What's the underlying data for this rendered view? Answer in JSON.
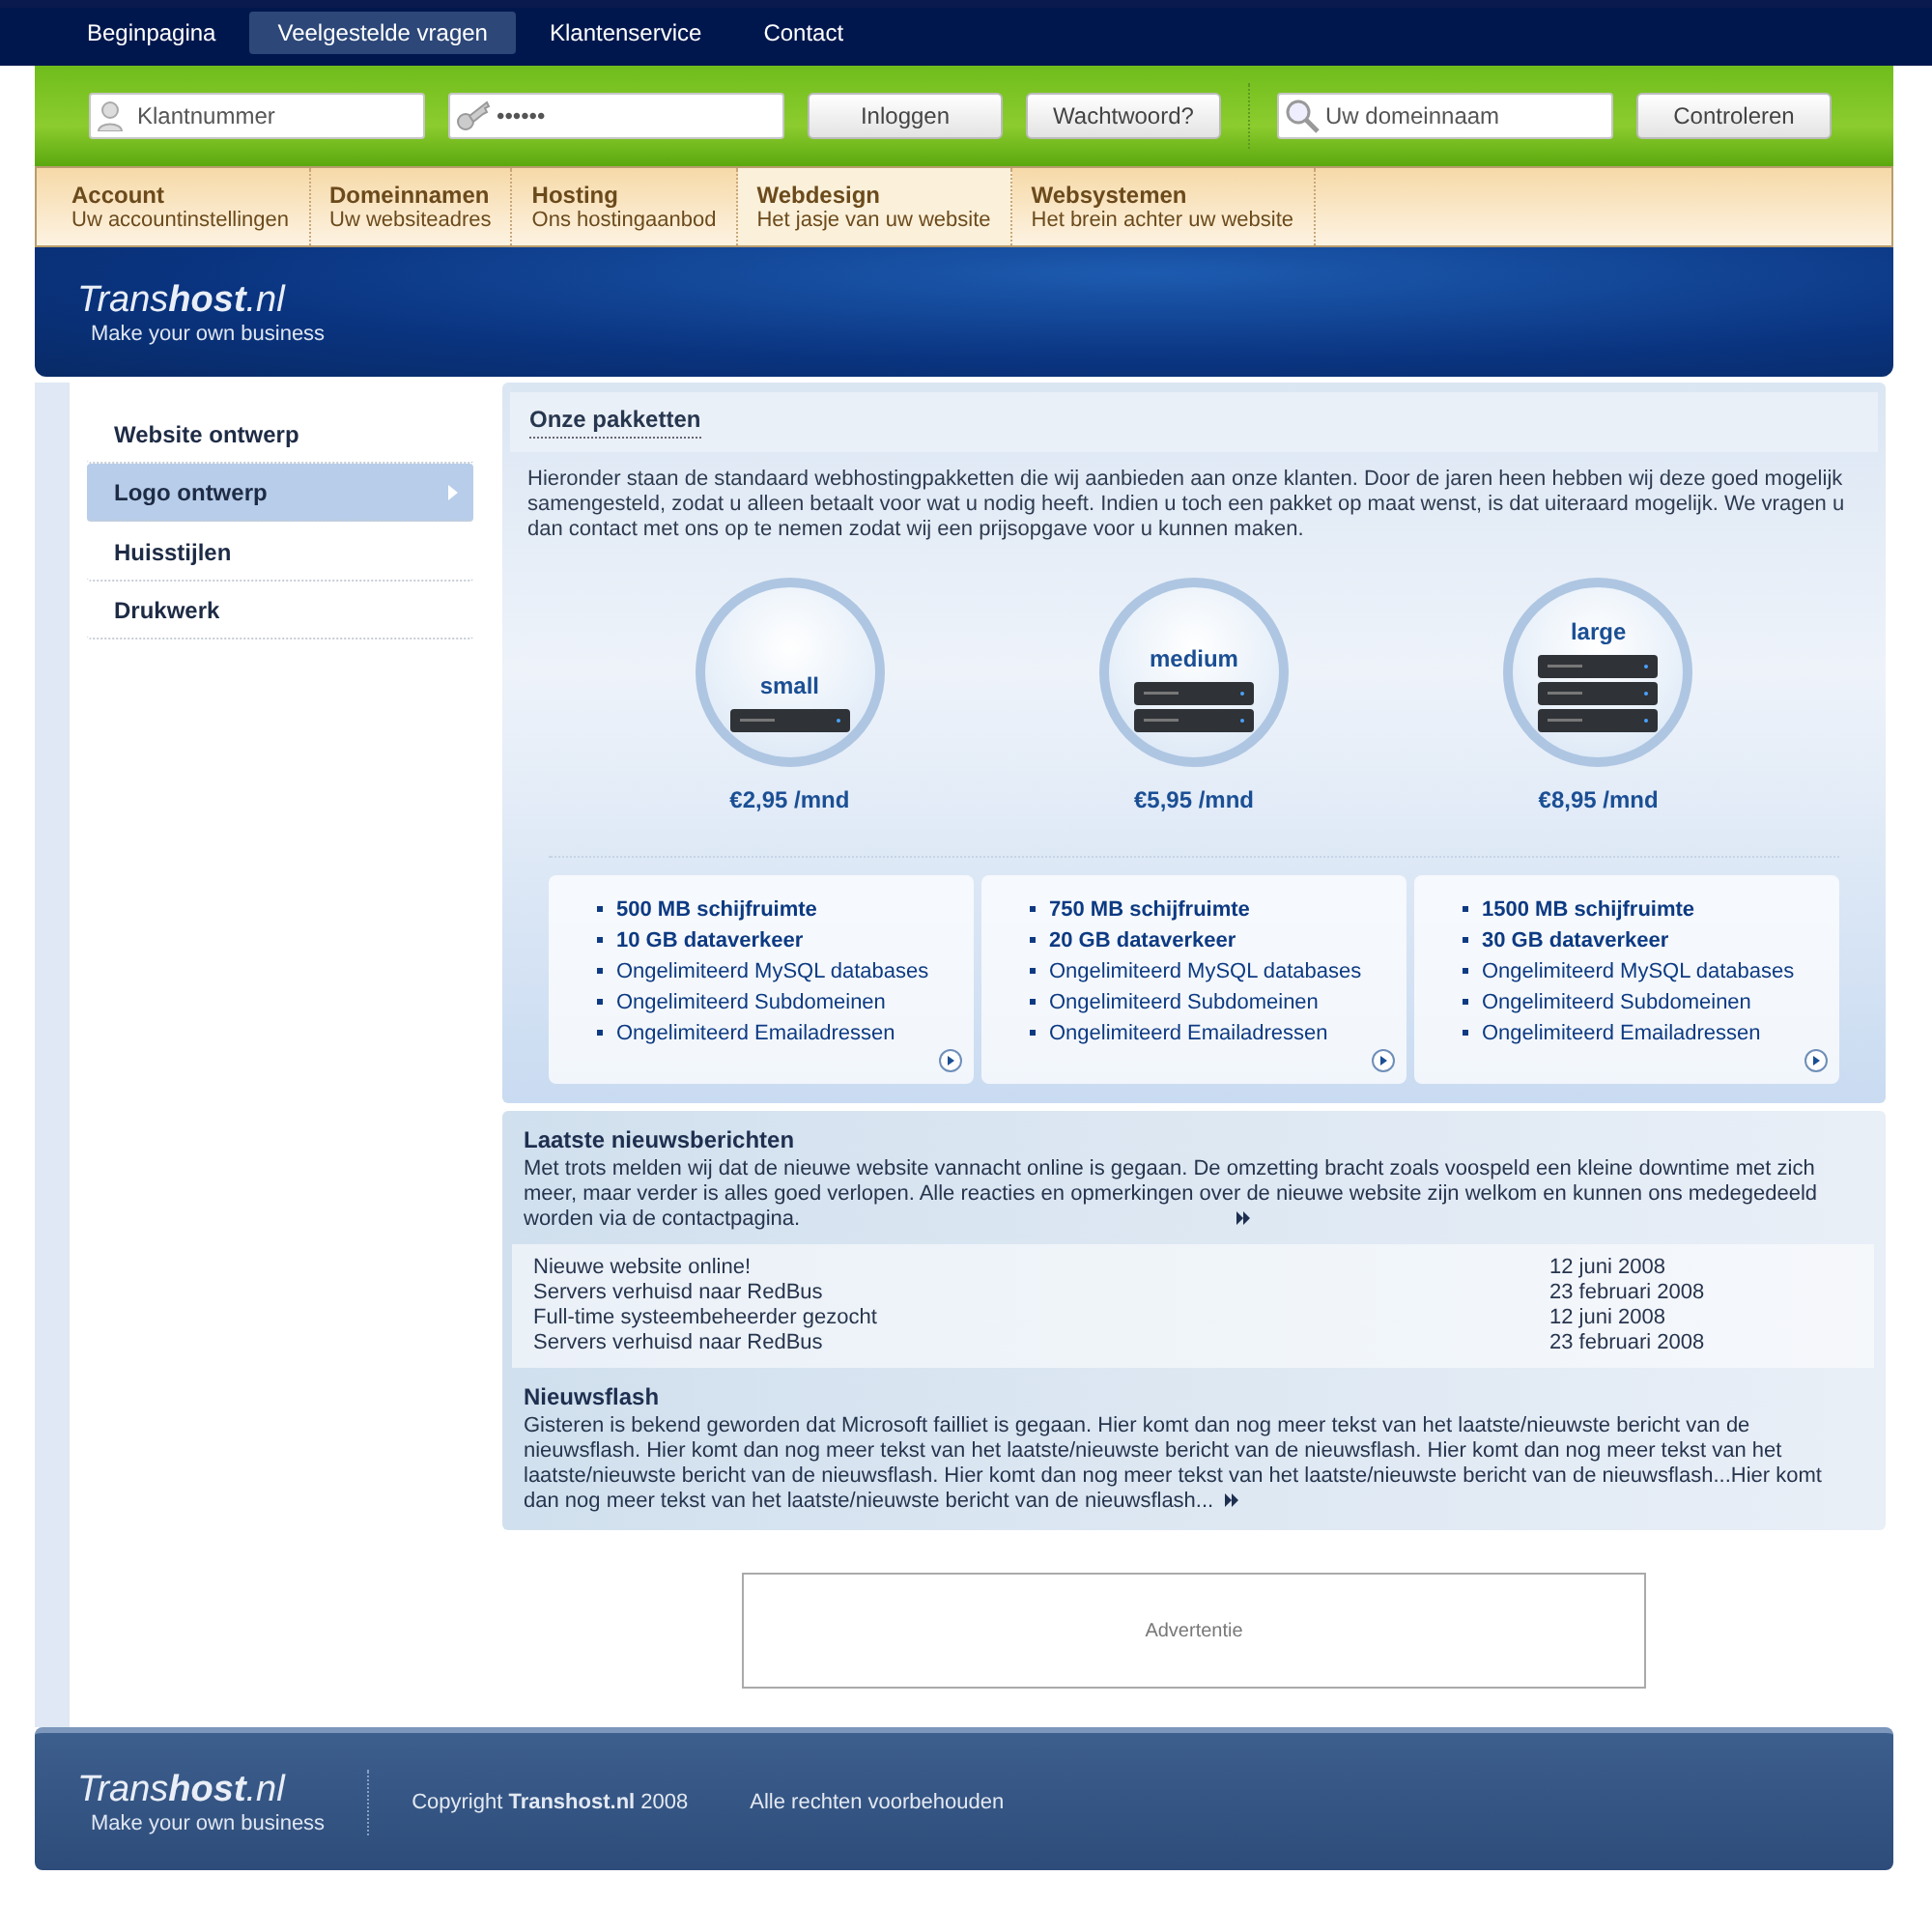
{
  "top_nav": [
    {
      "label": "Beginpagina",
      "selected": false
    },
    {
      "label": "Veelgestelde vragen",
      "selected": true
    },
    {
      "label": "Klantenservice",
      "selected": false
    },
    {
      "label": "Contact",
      "selected": false
    }
  ],
  "login_bar": {
    "customer_field": {
      "placeholder": "Klantnummer"
    },
    "password_field": {
      "value": "••••••"
    },
    "login_button": "Inloggen",
    "password_button": "Wachtwoord?",
    "domain_field": {
      "placeholder": "Uw domeinnaam"
    },
    "check_button": "Controleren"
  },
  "main_menu": [
    {
      "title": "Account",
      "subtitle": "Uw accountinstellingen",
      "selected": false
    },
    {
      "title": "Domeinnamen",
      "subtitle": "Uw websiteadres",
      "selected": false
    },
    {
      "title": "Hosting",
      "subtitle": "Ons hostingaanbod",
      "selected": false
    },
    {
      "title": "Webdesign",
      "subtitle": "Het jasje van uw website",
      "selected": true
    },
    {
      "title": "Websystemen",
      "subtitle": "Het brein achter uw website",
      "selected": false
    }
  ],
  "banner": {
    "logo": "Trans**host**.nl",
    "tagline": "Make your own business"
  },
  "sidebar": [
    {
      "label": "Website ontwerp",
      "selected": false
    },
    {
      "label": "Logo ontwerp",
      "selected": true
    },
    {
      "label": "Huisstijlen",
      "selected": false
    },
    {
      "label": "Drukwerk",
      "selected": false
    }
  ],
  "packages_section": {
    "title": "Onze pakketten",
    "intro": "Hieronder staan de standaard webhostingpakketten die wij aanbieden aan onze klanten. Door de jaren heen hebben wij deze goed mogelijk samengesteld, zodat u alleen betaalt voor wat u nodig heeft. Indien u toch een pakket op maat wenst, is dat uiteraard mogelijk. We vragen u dan contact met ons op te nemen zodat wij een prijsopgave voor u kunnen maken.",
    "packages": [
      {
        "name": "small",
        "price": "€2,95 /mnd",
        "features": [
          {
            "text": "500 MB schijfruimte",
            "bold": true
          },
          {
            "text": "10 GB dataverkeer",
            "bold": true
          },
          {
            "text": "Ongelimiteerd MySQL databases",
            "bold": false
          },
          {
            "text": "Ongelimiteerd Subdomeinen",
            "bold": false
          },
          {
            "text": "Ongelimiteerd Emailadressen",
            "bold": false
          }
        ]
      },
      {
        "name": "medium",
        "price": "€5,95 /mnd",
        "features": [
          {
            "text": "750 MB schijfruimte",
            "bold": true
          },
          {
            "text": "20 GB dataverkeer",
            "bold": true
          },
          {
            "text": "Ongelimiteerd MySQL databases",
            "bold": false
          },
          {
            "text": "Ongelimiteerd Subdomeinen",
            "bold": false
          },
          {
            "text": "Ongelimiteerd Emailadressen",
            "bold": false
          }
        ]
      },
      {
        "name": "large",
        "price": "€8,95 /mnd",
        "features": [
          {
            "text": "1500 MB schijfruimte",
            "bold": true
          },
          {
            "text": "30 GB dataverkeer",
            "bold": true
          },
          {
            "text": "Ongelimiteerd MySQL databases",
            "bold": false
          },
          {
            "text": "Ongelimiteerd Subdomeinen",
            "bold": false
          },
          {
            "text": "Ongelimiteerd Emailadressen",
            "bold": false
          }
        ]
      }
    ]
  },
  "news": {
    "title": "Laatste nieuwsberichten",
    "text": "Met trots melden wij dat de nieuwe website vannacht online is gegaan. De omzetting bracht zoals voospeld een kleine downtime met zich meer, maar verder is alles goed verlopen. Alle reacties en opmerkingen over de nieuwe website zijn welkom en kunnen ons medegedeeld worden via de contactpagina.",
    "items": [
      {
        "title": "Nieuwe website online!",
        "date": "12 juni 2008"
      },
      {
        "title": "Servers verhuisd naar RedBus",
        "date": "23 februari 2008"
      },
      {
        "title": "Full-time systeembeheerder gezocht",
        "date": "12 juni 2008"
      },
      {
        "title": "Servers verhuisd naar RedBus",
        "date": "23 februari 2008"
      }
    ]
  },
  "newsflash": {
    "title": "Nieuwsflash",
    "text": "Gisteren is bekend geworden dat Microsoft failliet is gegaan. Hier komt dan nog meer tekst van het laatste/nieuwste bericht van de nieuwsflash. Hier komt dan nog meer tekst van het laatste/nieuwste bericht van de nieuwsflash. Hier komt dan nog meer tekst van het laatste/nieuwste bericht van de nieuwsflash. Hier komt dan nog meer tekst van het laatste/nieuwste bericht van de nieuwsflash...Hier komt dan nog meer tekst van het laatste/nieuwste bericht van de nieuwsflash..."
  },
  "advertisement": {
    "label": "Advertentie"
  },
  "footer": {
    "logo": "Trans**host**.nl",
    "tagline": "Make your own business",
    "copyright": "Copyright **Transhost.nl** 2008",
    "rights": "Alle rechten voorbehouden"
  }
}
